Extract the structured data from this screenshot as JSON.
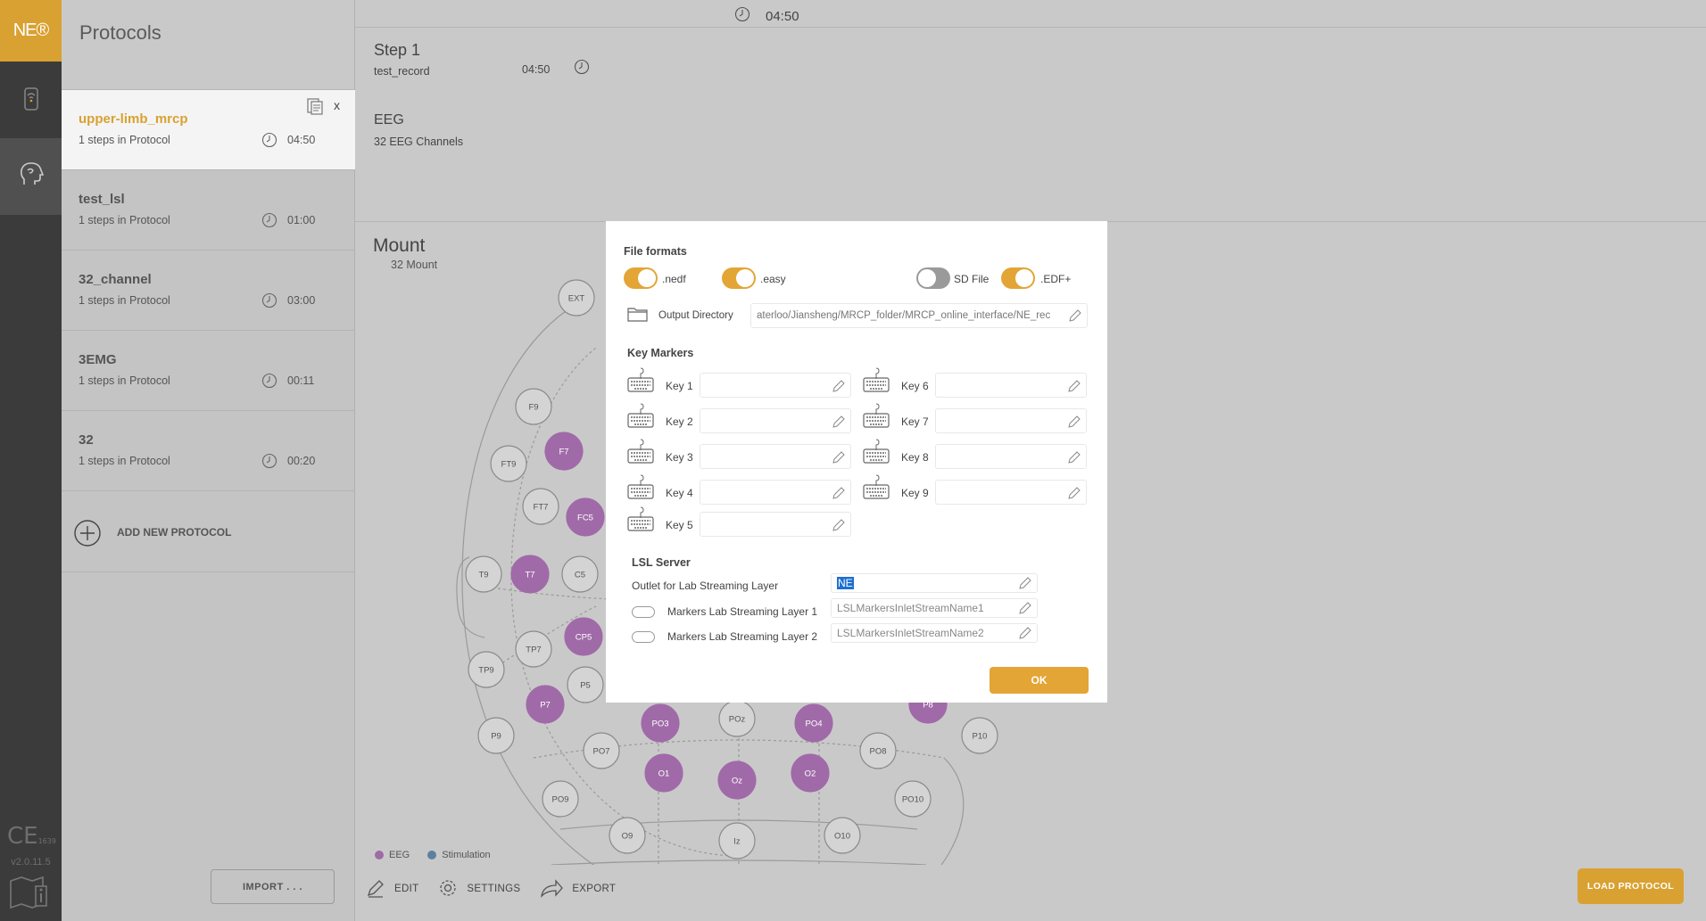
{
  "app": {
    "logo_text": "NE®",
    "version": "v2.0.11.5",
    "ce_mark": "CE",
    "ce_number": "1639"
  },
  "protocols_panel": {
    "title": "Protocols",
    "items": [
      {
        "name": "upper-limb_mrcp",
        "steps": "1 steps in Protocol",
        "time": "04:50",
        "active": true
      },
      {
        "name": "test_lsl",
        "steps": "1 steps in Protocol",
        "time": "01:00"
      },
      {
        "name": "32_channel",
        "steps": "1 steps in Protocol",
        "time": "03:00"
      },
      {
        "name": "3EMG",
        "steps": "1 steps in Protocol",
        "time": "00:11"
      },
      {
        "name": "32",
        "steps": "1 steps in Protocol",
        "time": "00:20"
      }
    ],
    "close_label": "x",
    "add_label": "ADD NEW PROTOCOL",
    "import_label": "IMPORT . . ."
  },
  "topbar": {
    "time": "04:50"
  },
  "step": {
    "title": "Step 1",
    "name": "test_record",
    "time": "04:50",
    "eeg_title": "EEG",
    "eeg_sub": "32 EEG Channels"
  },
  "mount": {
    "title": "Mount",
    "sub": "32 Mount",
    "electrodes": [
      {
        "label": "EXT",
        "active": false
      },
      {
        "label": "F9",
        "active": false
      },
      {
        "label": "F7",
        "active": true
      },
      {
        "label": "FT9",
        "active": false
      },
      {
        "label": "FT7",
        "active": false
      },
      {
        "label": "FC5",
        "active": true
      },
      {
        "label": "T9",
        "active": false
      },
      {
        "label": "T7",
        "active": true
      },
      {
        "label": "C5",
        "active": false
      },
      {
        "label": "TP7",
        "active": false
      },
      {
        "label": "CP5",
        "active": true
      },
      {
        "label": "TP9",
        "active": false
      },
      {
        "label": "P5",
        "active": false
      },
      {
        "label": "P7",
        "active": true
      },
      {
        "label": "P9",
        "active": false
      },
      {
        "label": "PO7",
        "active": false
      },
      {
        "label": "PO3",
        "active": true
      },
      {
        "label": "POz",
        "active": false
      },
      {
        "label": "PO4",
        "active": true
      },
      {
        "label": "P8",
        "active": true
      },
      {
        "label": "PO8",
        "active": false
      },
      {
        "label": "P10",
        "active": false
      },
      {
        "label": "O1",
        "active": true
      },
      {
        "label": "Oz",
        "active": true
      },
      {
        "label": "O2",
        "active": true
      },
      {
        "label": "PO9",
        "active": false
      },
      {
        "label": "PO10",
        "active": false
      },
      {
        "label": "O9",
        "active": false
      },
      {
        "label": "Iz",
        "active": false
      },
      {
        "label": "O10",
        "active": false
      }
    ],
    "legend": {
      "eeg": "EEG",
      "stimulation": "Stimulation"
    }
  },
  "tools": {
    "edit": "EDIT",
    "settings": "SETTINGS",
    "export": "EXPORT"
  },
  "load_button": "LOAD PROTOCOL",
  "modal": {
    "file_formats_title": "File formats",
    "formats": [
      {
        "label": ".nedf",
        "on": true
      },
      {
        "label": ".easy",
        "on": true
      },
      {
        "label": "SD File",
        "on": false
      },
      {
        "label": ".EDF+",
        "on": true
      }
    ],
    "output_dir_label": "Output Directory",
    "output_dir_value": "aterloo/Jiansheng/MRCP_folder/MRCP_online_interface/NE_rec",
    "key_markers_title": "Key Markers",
    "keys": [
      "Key 1",
      "Key 2",
      "Key 3",
      "Key 4",
      "Key 5",
      "Key 6",
      "Key 7",
      "Key 8",
      "Key 9"
    ],
    "lsl_title": "LSL Server",
    "outlet_label": "Outlet for Lab Streaming Layer",
    "outlet_value": "NE",
    "markers1_label": "Markers Lab Streaming Layer 1",
    "markers1_placeholder": "LSLMarkersInletStreamName1",
    "markers2_label": "Markers Lab Streaming Layer 2",
    "markers2_placeholder": "LSLMarkersInletStreamName2",
    "ok_label": "OK"
  },
  "colors": {
    "accent": "#d9a131",
    "eeg": "#a06aa8",
    "stimulation": "#5f7fa0"
  }
}
